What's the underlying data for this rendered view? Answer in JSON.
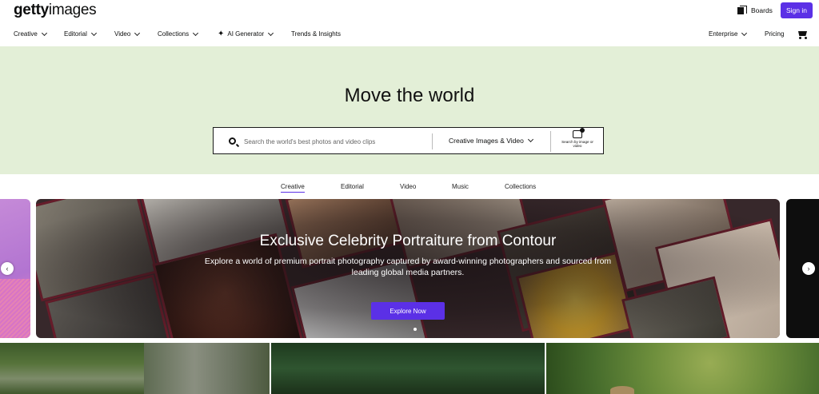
{
  "header": {
    "logo_bold": "getty",
    "logo_light": "images",
    "boards_label": "Boards",
    "sign_in_label": "Sign in",
    "accent_color": "#5b30e6"
  },
  "nav": {
    "items": [
      {
        "label": "Creative",
        "dropdown": true
      },
      {
        "label": "Editorial",
        "dropdown": true
      },
      {
        "label": "Video",
        "dropdown": true
      },
      {
        "label": "Collections",
        "dropdown": true
      },
      {
        "label": "AI Generator",
        "dropdown": true,
        "icon": "sparkle-icon"
      },
      {
        "label": "Trends & Insights",
        "dropdown": false
      }
    ],
    "right_items": [
      {
        "label": "Enterprise",
        "dropdown": true
      },
      {
        "label": "Pricing",
        "dropdown": false
      }
    ],
    "cart_icon": "cart-icon"
  },
  "hero": {
    "title": "Move the world",
    "background": "#e3efd7",
    "search": {
      "placeholder": "Search the world's best photos and video clips",
      "type_selected": "Creative Images & Video",
      "search_by_image_label": "Search by image or video"
    }
  },
  "tabs": {
    "items": [
      "Creative",
      "Editorial",
      "Video",
      "Music",
      "Collections"
    ],
    "active": "Creative"
  },
  "carousel": {
    "title": "Exclusive Celebrity Portraiture from Contour",
    "description": "Explore a world of premium portrait photography captured by award-winning photographers and sourced from leading global media partners.",
    "cta_label": "Explore Now",
    "prev_icon": "chevron-left-icon",
    "next_icon": "chevron-right-icon"
  }
}
